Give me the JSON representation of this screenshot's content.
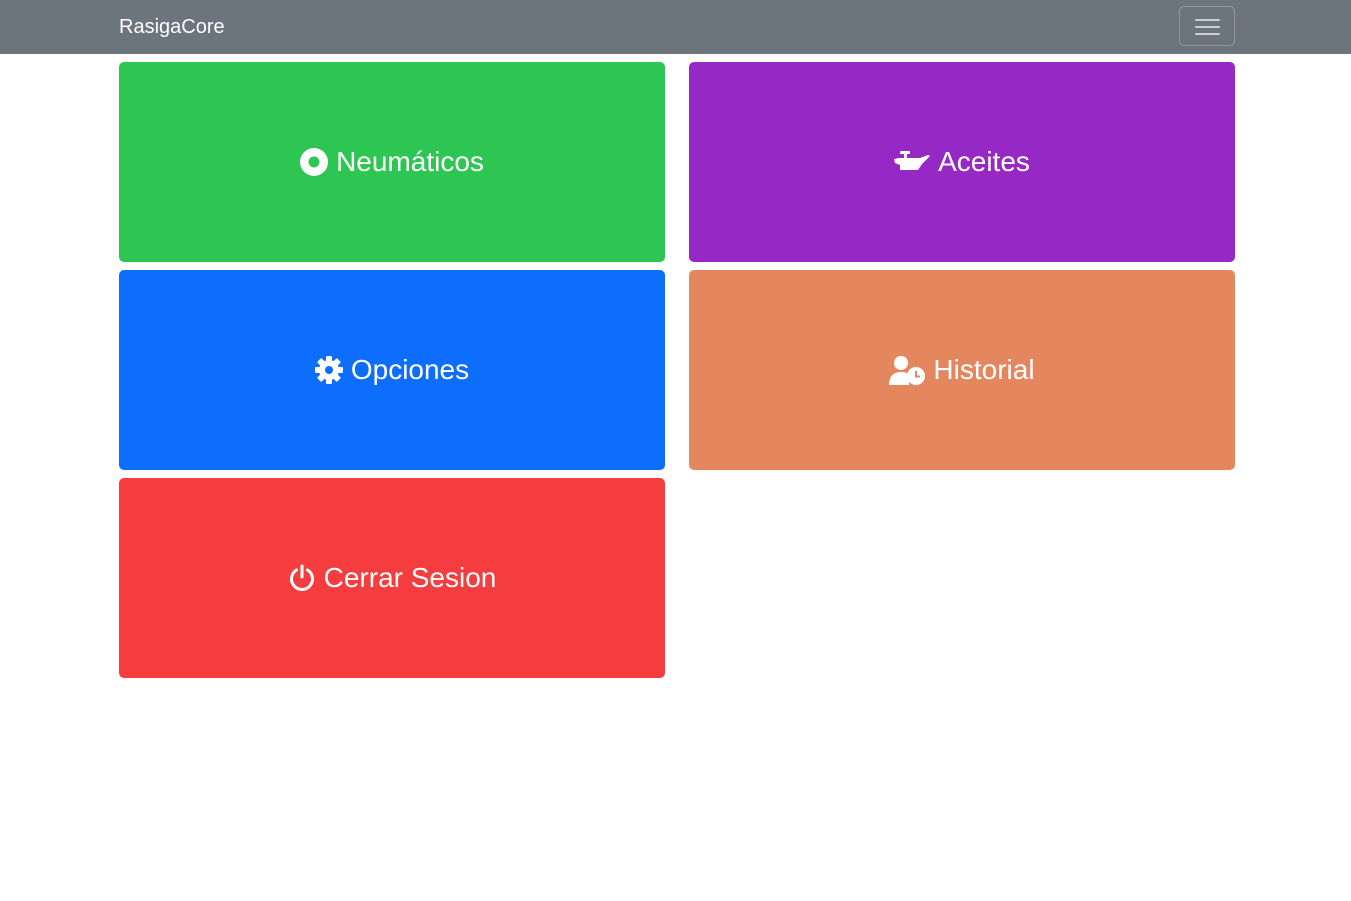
{
  "navbar": {
    "brand": "RasigaCore",
    "toggler_icon": "hamburger-menu-icon",
    "background": "#6c757d"
  },
  "tiles": [
    {
      "label": "Neumáticos",
      "icon": "tire-icon",
      "color": "#2dc653"
    },
    {
      "label": "Aceites",
      "icon": "oil-can-icon",
      "color": "#9629c6"
    },
    {
      "label": "Opciones",
      "icon": "gear-icon",
      "color": "#0d6efd"
    },
    {
      "label": "Historial",
      "icon": "user-clock-icon",
      "color": "#e4875f"
    },
    {
      "label": "Cerrar Sesion",
      "icon": "power-icon",
      "color": "#f53d3f"
    }
  ]
}
